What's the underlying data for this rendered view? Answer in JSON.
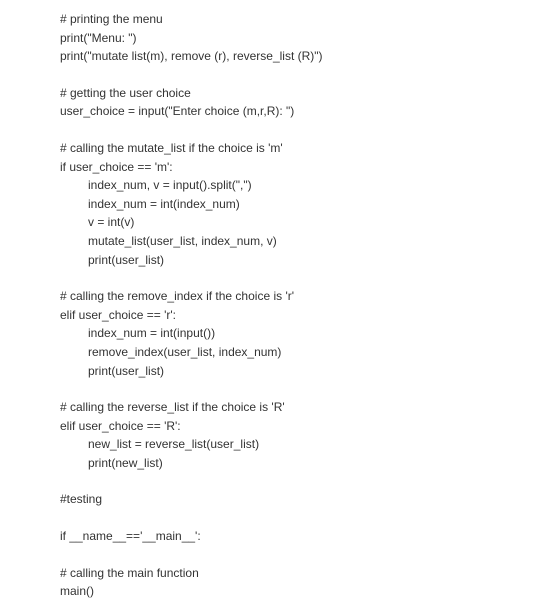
{
  "lines": [
    {
      "indent": "indent1",
      "text": "# printing the menu"
    },
    {
      "indent": "indent1",
      "text": "print(\"Menu: \")"
    },
    {
      "indent": "indent1",
      "text": "print(\"mutate list(m), remove (r), reverse_list (R)\")"
    },
    {
      "indent": "blank",
      "text": ""
    },
    {
      "indent": "indent1",
      "text": "# getting the user choice"
    },
    {
      "indent": "indent1",
      "text": "user_choice = input(\"Enter choice (m,r,R): \")"
    },
    {
      "indent": "blank",
      "text": ""
    },
    {
      "indent": "indent1",
      "text": "# calling the mutate_list if the choice is 'm'"
    },
    {
      "indent": "indent1",
      "text": "if user_choice == 'm':"
    },
    {
      "indent": "indent2",
      "text": "index_num, v = input().split(\",\")"
    },
    {
      "indent": "indent2",
      "text": "index_num = int(index_num)"
    },
    {
      "indent": "indent2",
      "text": "v = int(v)"
    },
    {
      "indent": "indent2",
      "text": "mutate_list(user_list, index_num, v)"
    },
    {
      "indent": "indent2",
      "text": "print(user_list)"
    },
    {
      "indent": "blank",
      "text": ""
    },
    {
      "indent": "indent1",
      "text": "# calling the remove_index if the choice is 'r'"
    },
    {
      "indent": "indent1",
      "text": "elif user_choice == 'r':"
    },
    {
      "indent": "indent2",
      "text": "index_num = int(input())"
    },
    {
      "indent": "indent2",
      "text": "remove_index(user_list, index_num)"
    },
    {
      "indent": "indent2",
      "text": "print(user_list)"
    },
    {
      "indent": "blank",
      "text": ""
    },
    {
      "indent": "indent1",
      "text": "# calling the reverse_list if the choice is 'R'"
    },
    {
      "indent": "indent1",
      "text": "elif user_choice == 'R':"
    },
    {
      "indent": "indent2",
      "text": "new_list = reverse_list(user_list)"
    },
    {
      "indent": "indent2",
      "text": "print(new_list)"
    },
    {
      "indent": "blank",
      "text": ""
    },
    {
      "indent": "indent0",
      "text": "#testing"
    },
    {
      "indent": "blank",
      "text": ""
    },
    {
      "indent": "indent0",
      "text": "if __name__=='__main__':"
    },
    {
      "indent": "blank",
      "text": ""
    },
    {
      "indent": "indent1",
      "text": "# calling the main function"
    },
    {
      "indent": "indent1",
      "text": "main()"
    }
  ]
}
